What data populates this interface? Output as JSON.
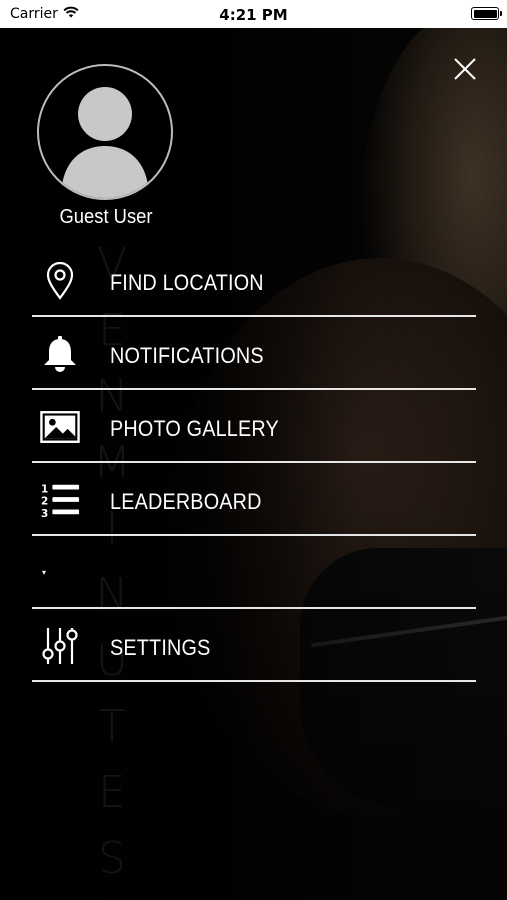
{
  "status_bar": {
    "carrier": "Carrier",
    "time": "4:21 PM",
    "battery_level_percent": 100
  },
  "drawer": {
    "close_icon": "close-icon",
    "user_name": "Guest User",
    "avatar_icon": "person-placeholder-icon",
    "menu_items": [
      {
        "label": "FIND LOCATION",
        "icon": "location-pin-icon"
      },
      {
        "label": "NOTIFICATIONS",
        "icon": "bell-icon"
      },
      {
        "label": "PHOTO GALLERY",
        "icon": "image-icon"
      },
      {
        "label": "LEADERBOARD",
        "icon": "ranked-list-icon"
      },
      {
        "label": "",
        "icon": "bullet-icon"
      },
      {
        "label": "SETTINGS",
        "icon": "sliders-icon"
      }
    ]
  },
  "background": {
    "watermark_letters": [
      "V",
      "E",
      "N",
      "M",
      "I",
      "N",
      "U",
      "T",
      "E",
      "S"
    ]
  },
  "colors": {
    "background": "#000000",
    "text": "#ffffff",
    "divider": "#e6e6e6",
    "status_bar": "#ffffff"
  }
}
